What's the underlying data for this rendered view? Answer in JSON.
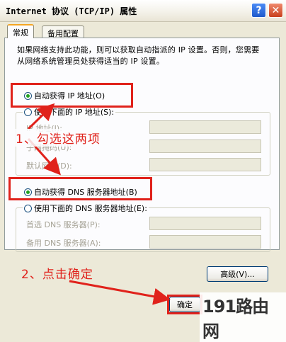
{
  "window": {
    "title": "Internet 协议 (TCP/IP) 属性",
    "help": "?",
    "close": "✕"
  },
  "tabs": [
    {
      "label": "常规"
    },
    {
      "label": "备用配置"
    }
  ],
  "description": "如果网络支持此功能，则可以获取自动指派的 IP 设置。否则，您需要从网络系统管理员处获得适当的 IP 设置。",
  "ip": {
    "auto_label": "自动获得 IP 地址(O)",
    "manual_label": "使用下面的 IP 地址(S):",
    "fields": [
      {
        "label": "IP 地址(I):"
      },
      {
        "label": "子网掩码(U):"
      },
      {
        "label": "默认网关(D):"
      }
    ]
  },
  "dns": {
    "auto_label": "自动获得 DNS 服务器地址(B)",
    "manual_label": "使用下面的 DNS 服务器地址(E):",
    "fields": [
      {
        "label": "首选 DNS 服务器(P):"
      },
      {
        "label": "备用 DNS 服务器(A):"
      }
    ]
  },
  "buttons": {
    "advanced": "高级(V)...",
    "ok": "确定"
  },
  "annotations": {
    "step1": "1、勾选这两项",
    "step2": "2、点击确定"
  },
  "watermark": "191路由网",
  "colors": {
    "annotation_red": "#E0221B",
    "radio_selected": "#21A121"
  }
}
